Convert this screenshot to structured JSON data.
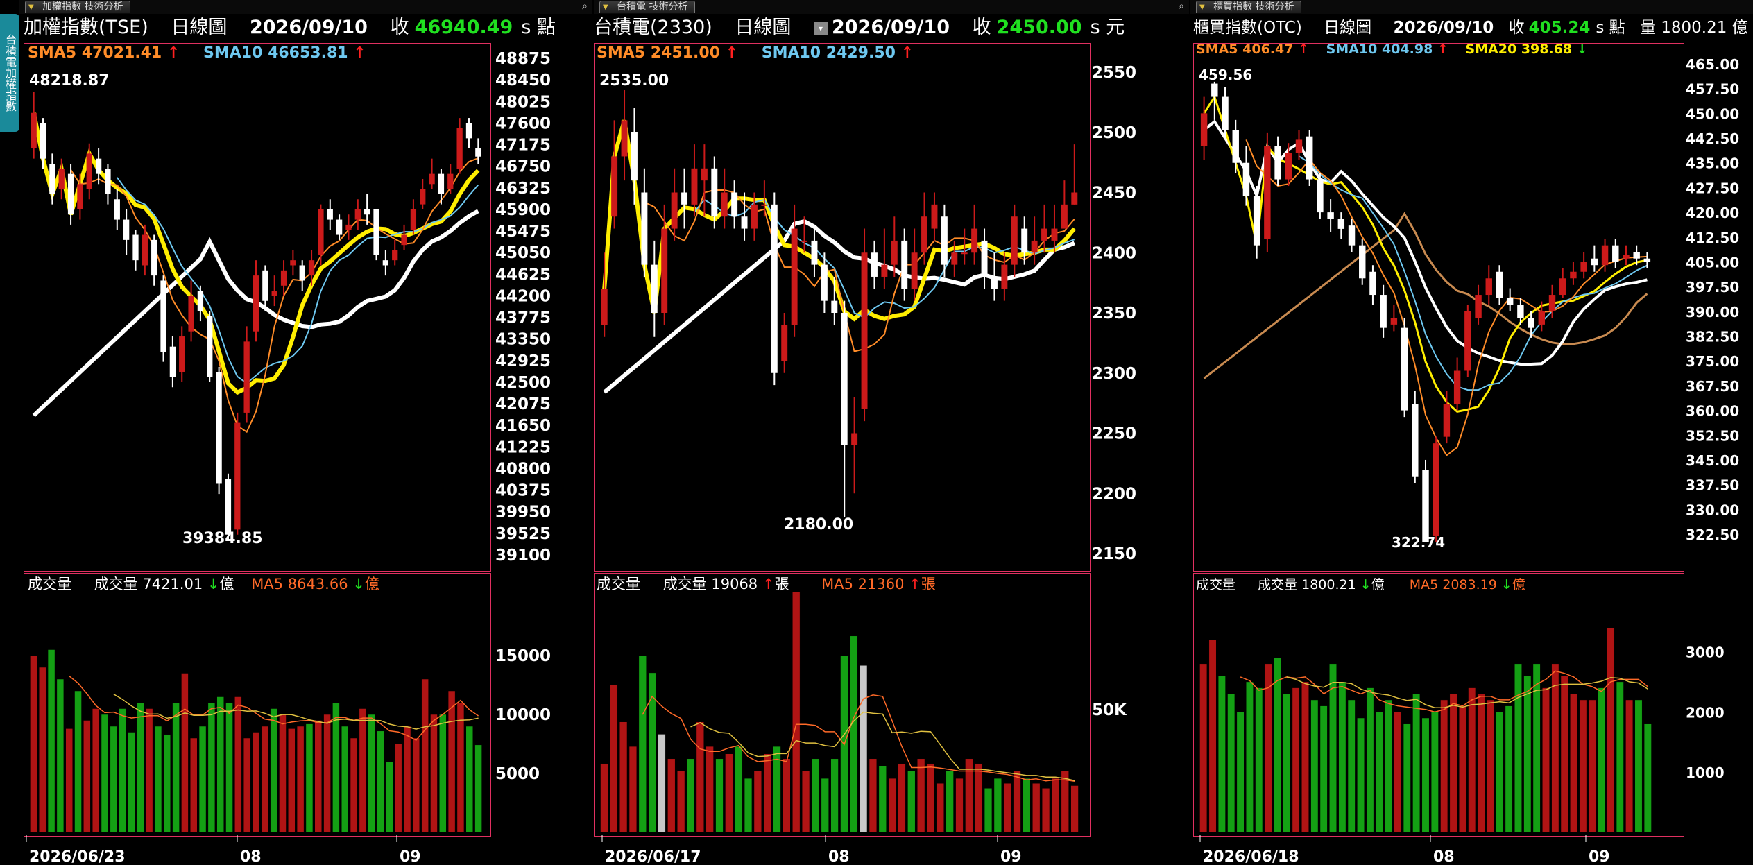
{
  "sidebar": {
    "label": "台積電加權指數"
  },
  "panels": [
    {
      "tab": "加權指數 技術分析",
      "name": "加權指數(TSE)",
      "period": "日線圖",
      "date": "2026/09/10",
      "close_label": "收",
      "close": "46940.49",
      "unit": "s 點",
      "volume_header": "",
      "ma": [
        {
          "label": "SMA5 47021.41",
          "arrow": "↑",
          "color": "#ff8c28"
        },
        {
          "label": "SMA10 46653.81",
          "arrow": "↑",
          "color": "#6ec8f0"
        }
      ],
      "yticks": [
        "48875",
        "48450",
        "48025",
        "47600",
        "47175",
        "46750",
        "46325",
        "45900",
        "45475",
        "45050",
        "44625",
        "44200",
        "43775",
        "43350",
        "42925",
        "42500",
        "42075",
        "41650",
        "41225",
        "40800",
        "40375",
        "39950",
        "39525",
        "39100"
      ],
      "high_label": "48218.87",
      "low_label": "39384.85",
      "vol_label": "成交量",
      "vol_value_label": "成交量 7421.01",
      "vol_value_arrow": "↓",
      "vol_value_unit": "億",
      "vol_ma_label": "MA5 8643.66",
      "vol_ma_arrow": "↓",
      "vol_ma_unit": "億",
      "vol_yticks": [
        "15000",
        "10000",
        "5000"
      ],
      "xlabels": [
        "2026/06/23",
        "08",
        "09"
      ]
    },
    {
      "tab": "台積電 技術分析",
      "name": "台積電(2330)",
      "period": "日線圖",
      "date": "2026/09/10",
      "close_label": "收",
      "close": "2450.00",
      "unit": "s 元",
      "volume_header": "",
      "ma": [
        {
          "label": "SMA5 2451.00",
          "arrow": "↑",
          "color": "#ff8c28"
        },
        {
          "label": "SMA10 2429.50",
          "arrow": "↑",
          "color": "#6ec8f0"
        }
      ],
      "yticks": [
        "2550",
        "2500",
        "2450",
        "2400",
        "2350",
        "2300",
        "2250",
        "2200",
        "2150"
      ],
      "high_label": "2535.00",
      "low_label": "2180.00",
      "vol_label": "成交量",
      "vol_value_label": "成交量 19068",
      "vol_value_arrow": "↑",
      "vol_value_unit": "張",
      "vol_ma_label": "MA5 21360",
      "vol_ma_arrow": "↑",
      "vol_ma_unit": "張",
      "vol_yticks": [
        "50K"
      ],
      "xlabels": [
        "2026/06/17",
        "08",
        "09"
      ]
    },
    {
      "tab": "櫃買指數 技術分析",
      "name": "櫃買指數(OTC)",
      "period": "日線圖",
      "date": "2026/09/10",
      "close_label": "收",
      "close": "405.24",
      "unit": "s 點",
      "volume_header": "量 1800.21 億",
      "ma": [
        {
          "label": "SMA5 406.47",
          "arrow": "↑",
          "color": "#ff8c28"
        },
        {
          "label": "SMA10 404.98",
          "arrow": "↑",
          "color": "#6ec8f0"
        },
        {
          "label": "SMA20 398.68",
          "arrow": "↓",
          "color": "#ffee00"
        }
      ],
      "yticks": [
        "465.00",
        "457.50",
        "450.00",
        "442.50",
        "435.00",
        "427.50",
        "420.00",
        "412.50",
        "405.00",
        "397.50",
        "390.00",
        "382.50",
        "375.00",
        "367.50",
        "360.00",
        "352.50",
        "345.00",
        "337.50",
        "330.00",
        "322.50"
      ],
      "high_label": "459.56",
      "low_label": "322.74",
      "vol_label": "成交量",
      "vol_value_label": "成交量 1800.21",
      "vol_value_arrow": "↓",
      "vol_value_unit": "億",
      "vol_ma_label": "MA5 2083.19",
      "vol_ma_arrow": "↓",
      "vol_ma_unit": "億",
      "vol_yticks": [
        "3000",
        "2000",
        "1000"
      ],
      "xlabels": [
        "2026/06/18",
        "08",
        "09"
      ]
    }
  ],
  "chart_data": [
    {
      "type": "candlestick",
      "title": "加權指數(TSE)",
      "ylim": [
        39100,
        48875
      ],
      "close": [
        47800,
        46900,
        46200,
        46700,
        45800,
        46400,
        47000,
        46600,
        46200,
        45700,
        45300,
        44900,
        45400,
        44600,
        43100,
        42600,
        43400,
        44200,
        43900,
        42600,
        40500,
        39500,
        41700,
        43300,
        44600,
        44100,
        44300,
        44700,
        44900,
        44500,
        44900,
        45900,
        45700,
        45400,
        45600,
        45900,
        45800,
        45000,
        44800,
        45100,
        45400,
        45900,
        46300,
        46600,
        46200,
        46600,
        47500,
        47300,
        46940
      ],
      "open": [
        47100,
        47600,
        46800,
        46300,
        46600,
        45900,
        46300,
        46900,
        46700,
        46100,
        45700,
        45400,
        44800,
        45300,
        44500,
        43200,
        42700,
        43500,
        44300,
        43800,
        42700,
        40600,
        39600,
        41900,
        43500,
        44700,
        44200,
        44400,
        44800,
        44800,
        44600,
        45000,
        45900,
        45700,
        45500,
        45700,
        45900,
        45900,
        44900,
        44900,
        45200,
        45500,
        46000,
        46400,
        46600,
        46300,
        46700,
        47600,
        47100
      ],
      "high": [
        48218,
        47700,
        47000,
        46900,
        46800,
        46600,
        47200,
        47100,
        46800,
        46300,
        45900,
        45500,
        45600,
        45400,
        44600,
        43400,
        43600,
        44500,
        44400,
        43900,
        42800,
        40700,
        41900,
        43600,
        44900,
        44800,
        44600,
        44900,
        45100,
        44900,
        45100,
        46000,
        46100,
        45800,
        45800,
        46100,
        46200,
        45900,
        45100,
        45300,
        45600,
        46100,
        46500,
        46900,
        46700,
        46800,
        47700,
        47700,
        47300
      ],
      "low": [
        46900,
        46700,
        46000,
        46100,
        45600,
        45700,
        46100,
        46400,
        46000,
        45500,
        45000,
        44700,
        44600,
        44400,
        42900,
        42400,
        42500,
        43300,
        43700,
        42500,
        40300,
        39384,
        39500,
        41700,
        43300,
        43900,
        44000,
        44200,
        44600,
        44300,
        44400,
        44800,
        45500,
        45300,
        45300,
        45500,
        45600,
        44900,
        44600,
        44800,
        45100,
        45400,
        45900,
        46300,
        46000,
        46200,
        46600,
        47100,
        46800
      ],
      "sma5_last": "47021.41",
      "sma10_last": "46653.81",
      "volume": [
        15000,
        14000,
        15500,
        13000,
        8800,
        12000,
        9500,
        10500,
        10000,
        9000,
        10500,
        8500,
        11000,
        10500,
        9000,
        8300,
        11000,
        13500,
        8000,
        9000,
        11000,
        11500,
        11000,
        11500,
        8000,
        8500,
        9000,
        10500,
        10000,
        8800,
        9000,
        9200,
        9500,
        10000,
        11000,
        9000,
        8000,
        10500,
        10000,
        8600,
        6000,
        7500,
        9000,
        8000,
        13000,
        10000,
        10000,
        12000,
        11000,
        9000,
        7421
      ],
      "volume_colors": "red=up green=down"
    },
    {
      "type": "candlestick",
      "title": "台積電(2330)",
      "ylim": [
        2150,
        2550
      ],
      "close": [
        2370,
        2480,
        2510,
        2460,
        2390,
        2350,
        2420,
        2450,
        2440,
        2470,
        2470,
        2430,
        2450,
        2430,
        2420,
        2440,
        2440,
        2300,
        2340,
        2420,
        2410,
        2390,
        2360,
        2350,
        2240,
        2250,
        2400,
        2380,
        2390,
        2410,
        2370,
        2400,
        2430,
        2440,
        2390,
        2400,
        2400,
        2420,
        2380,
        2370,
        2390,
        2430,
        2400,
        2410,
        2420,
        2420,
        2440,
        2450
      ],
      "open": [
        2340,
        2430,
        2480,
        2500,
        2450,
        2390,
        2350,
        2420,
        2450,
        2440,
        2460,
        2470,
        2430,
        2450,
        2430,
        2420,
        2440,
        2440,
        2310,
        2340,
        2410,
        2410,
        2390,
        2360,
        2350,
        2240,
        2270,
        2400,
        2380,
        2390,
        2410,
        2370,
        2400,
        2420,
        2430,
        2390,
        2400,
        2400,
        2410,
        2380,
        2370,
        2390,
        2420,
        2400,
        2410,
        2410,
        2420,
        2440
      ],
      "high": [
        2400,
        2510,
        2535,
        2520,
        2470,
        2410,
        2440,
        2470,
        2470,
        2490,
        2490,
        2480,
        2470,
        2460,
        2450,
        2450,
        2460,
        2450,
        2350,
        2440,
        2430,
        2420,
        2400,
        2380,
        2360,
        2280,
        2420,
        2410,
        2420,
        2430,
        2420,
        2420,
        2450,
        2450,
        2440,
        2410,
        2420,
        2440,
        2420,
        2400,
        2400,
        2440,
        2430,
        2430,
        2440,
        2440,
        2460,
        2490
      ],
      "low": [
        2330,
        2420,
        2460,
        2440,
        2380,
        2330,
        2340,
        2410,
        2420,
        2430,
        2430,
        2420,
        2420,
        2420,
        2410,
        2410,
        2430,
        2290,
        2300,
        2330,
        2400,
        2380,
        2350,
        2340,
        2180,
        2200,
        2260,
        2370,
        2370,
        2380,
        2360,
        2360,
        2390,
        2410,
        2380,
        2380,
        2390,
        2390,
        2370,
        2360,
        2360,
        2380,
        2390,
        2390,
        2400,
        2400,
        2420,
        2440
      ],
      "sma5_last": "2451.00",
      "sma10_last": "2429.50",
      "volume": [
        28000,
        60000,
        45000,
        35000,
        72000,
        65000,
        40000,
        30000,
        25000,
        30000,
        45000,
        35000,
        30000,
        32000,
        35000,
        22000,
        25000,
        32000,
        35000,
        30000,
        98000,
        25000,
        30000,
        22000,
        30000,
        72000,
        80000,
        68000,
        30000,
        27000,
        22000,
        28000,
        25000,
        30000,
        28000,
        20000,
        25000,
        22000,
        30000,
        28000,
        18000,
        22000,
        20000,
        25000,
        22000,
        20000,
        18000,
        22000,
        25000,
        19068
      ],
      "volume_colors": "red=up green=down grey=flat"
    },
    {
      "type": "candlestick",
      "title": "櫃買指數(OTC)",
      "ylim": [
        322.5,
        465
      ],
      "close": [
        450,
        455,
        445,
        435,
        425,
        410,
        440,
        430,
        438,
        442,
        430,
        420,
        418,
        415,
        410,
        400,
        395,
        385,
        388,
        360,
        340,
        320,
        350,
        362,
        372,
        390,
        395,
        400,
        394,
        392,
        388,
        385,
        390,
        395,
        400,
        402,
        405,
        404,
        410,
        405,
        407,
        406,
        405
      ],
      "open": [
        440,
        459,
        455,
        445,
        435,
        425,
        412,
        440,
        430,
        438,
        443,
        430,
        420,
        418,
        416,
        410,
        402,
        395,
        386,
        385,
        362,
        342,
        322,
        352,
        362,
        372,
        388,
        395,
        402,
        394,
        392,
        388,
        386,
        390,
        395,
        400,
        402,
        406,
        404,
        410,
        406,
        408,
        406
      ],
      "high": [
        455,
        459.56,
        458,
        448,
        440,
        428,
        444,
        443,
        441,
        445,
        445,
        432,
        424,
        420,
        418,
        412,
        404,
        398,
        392,
        388,
        366,
        345,
        352,
        366,
        376,
        392,
        398,
        404,
        404,
        397,
        394,
        390,
        393,
        398,
        403,
        405,
        408,
        410,
        412,
        412,
        410,
        410,
        408
      ],
      "low": [
        436,
        448,
        442,
        432,
        422,
        406,
        408,
        428,
        428,
        436,
        428,
        418,
        414,
        412,
        408,
        398,
        392,
        382,
        384,
        358,
        338,
        322.74,
        320,
        350,
        360,
        370,
        386,
        392,
        392,
        390,
        386,
        382,
        384,
        388,
        394,
        398,
        400,
        402,
        402,
        403,
        404,
        404,
        403
      ],
      "sma5_last": "406.47",
      "sma10_last": "404.98",
      "sma20_last": "398.68",
      "volume": [
        2800,
        3200,
        2600,
        2300,
        2000,
        2500,
        2400,
        2800,
        2900,
        2300,
        2400,
        2500,
        2200,
        2100,
        2800,
        2500,
        2200,
        1900,
        2400,
        2000,
        2200,
        2000,
        1800,
        2300,
        1900,
        2000,
        2200,
        2300,
        2100,
        2400,
        2300,
        2200,
        2000,
        2100,
        2800,
        2600,
        2800,
        2400,
        2800,
        2600,
        2300,
        2200,
        2200,
        2400,
        3400,
        2500,
        2200,
        2200,
        1800
      ],
      "volume_colors": "red=up green=down"
    }
  ]
}
